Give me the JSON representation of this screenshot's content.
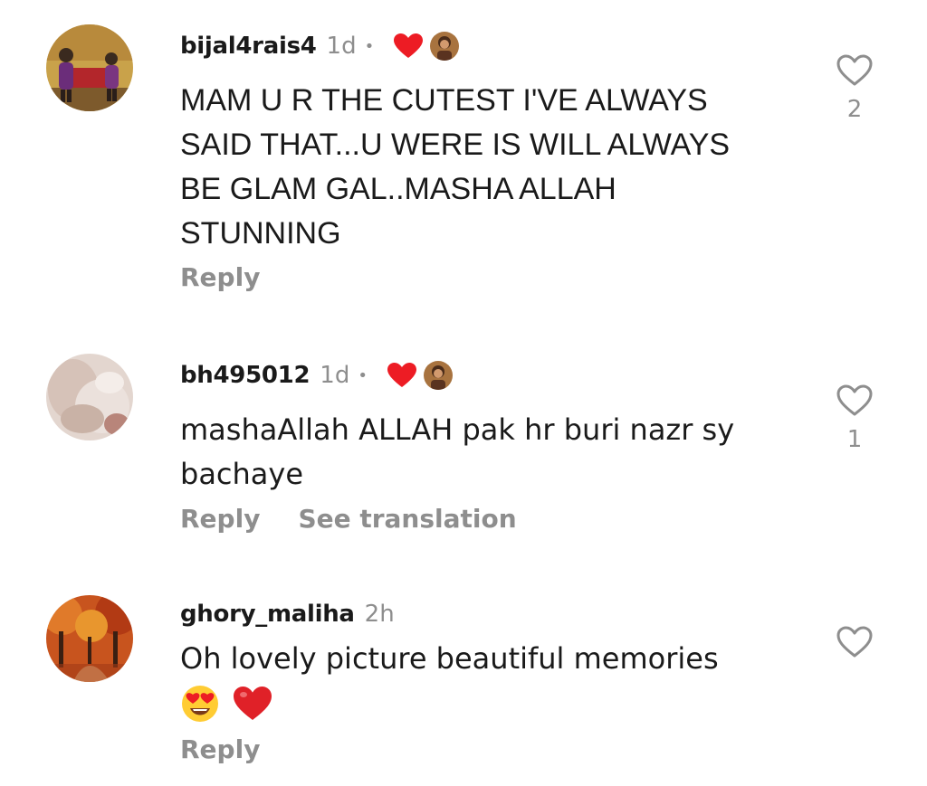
{
  "comments": [
    {
      "username": "bijal4rais4",
      "time": "1d",
      "separator": "•",
      "author_liked": true,
      "text": "MAM U R THE CUTEST I'VE ALWAYS SAID THAT...U WERE IS WILL ALWAYS BE GLAM GAL..MASHA ALLAH STUNNING",
      "reply_label": "Reply",
      "like_count": "2",
      "avatar_icon": "avatar-photo-two-girls"
    },
    {
      "username": "bh495012",
      "time": "1d",
      "separator": "•",
      "author_liked": true,
      "text": "mashaAllah ALLAH pak hr buri nazr sy bachaye",
      "reply_label": "Reply",
      "translation_label": "See translation",
      "like_count": "1",
      "avatar_icon": "avatar-photo-blurred"
    },
    {
      "username": "ghory_maliha",
      "time": "2h",
      "text": "Oh lovely picture beautiful memories",
      "emojis": [
        "😍",
        "❤️"
      ],
      "reply_label": "Reply",
      "avatar_icon": "avatar-photo-autumn-trees"
    }
  ],
  "colors": {
    "text": "#1a1a1a",
    "muted": "#8e8e8e",
    "heart": "#ed1c24"
  }
}
